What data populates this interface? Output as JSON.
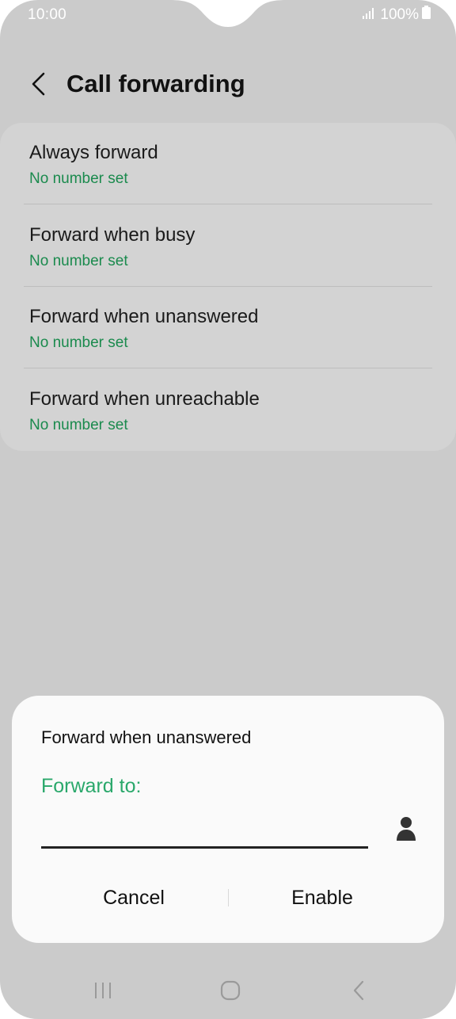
{
  "status_bar": {
    "time": "10:00",
    "battery_text": "100%",
    "icons": [
      "signal-icon",
      "battery-icon"
    ]
  },
  "header": {
    "title": "Call forwarding",
    "back_icon": "back-arrow-icon"
  },
  "list": {
    "items": [
      {
        "label": "Always forward",
        "sub": "No number set"
      },
      {
        "label": "Forward when busy",
        "sub": "No number set"
      },
      {
        "label": "Forward when unanswered",
        "sub": "No number set"
      },
      {
        "label": "Forward when unreachable",
        "sub": "No number set"
      }
    ]
  },
  "dialog": {
    "title": "Forward when unanswered",
    "field_label": "Forward to:",
    "field_value": "",
    "contact_icon": "contact-person-icon",
    "cancel_label": "Cancel",
    "enable_label": "Enable"
  },
  "navbar": {
    "icons": [
      "recent-apps-icon",
      "home-icon",
      "back-icon"
    ]
  },
  "colors": {
    "background": "#cbcbcb",
    "card": "#d3d3d3",
    "accent_green": "#1a8a4d",
    "dialog_label_green": "#2aa86b",
    "dialog_bg": "#fafafa"
  }
}
